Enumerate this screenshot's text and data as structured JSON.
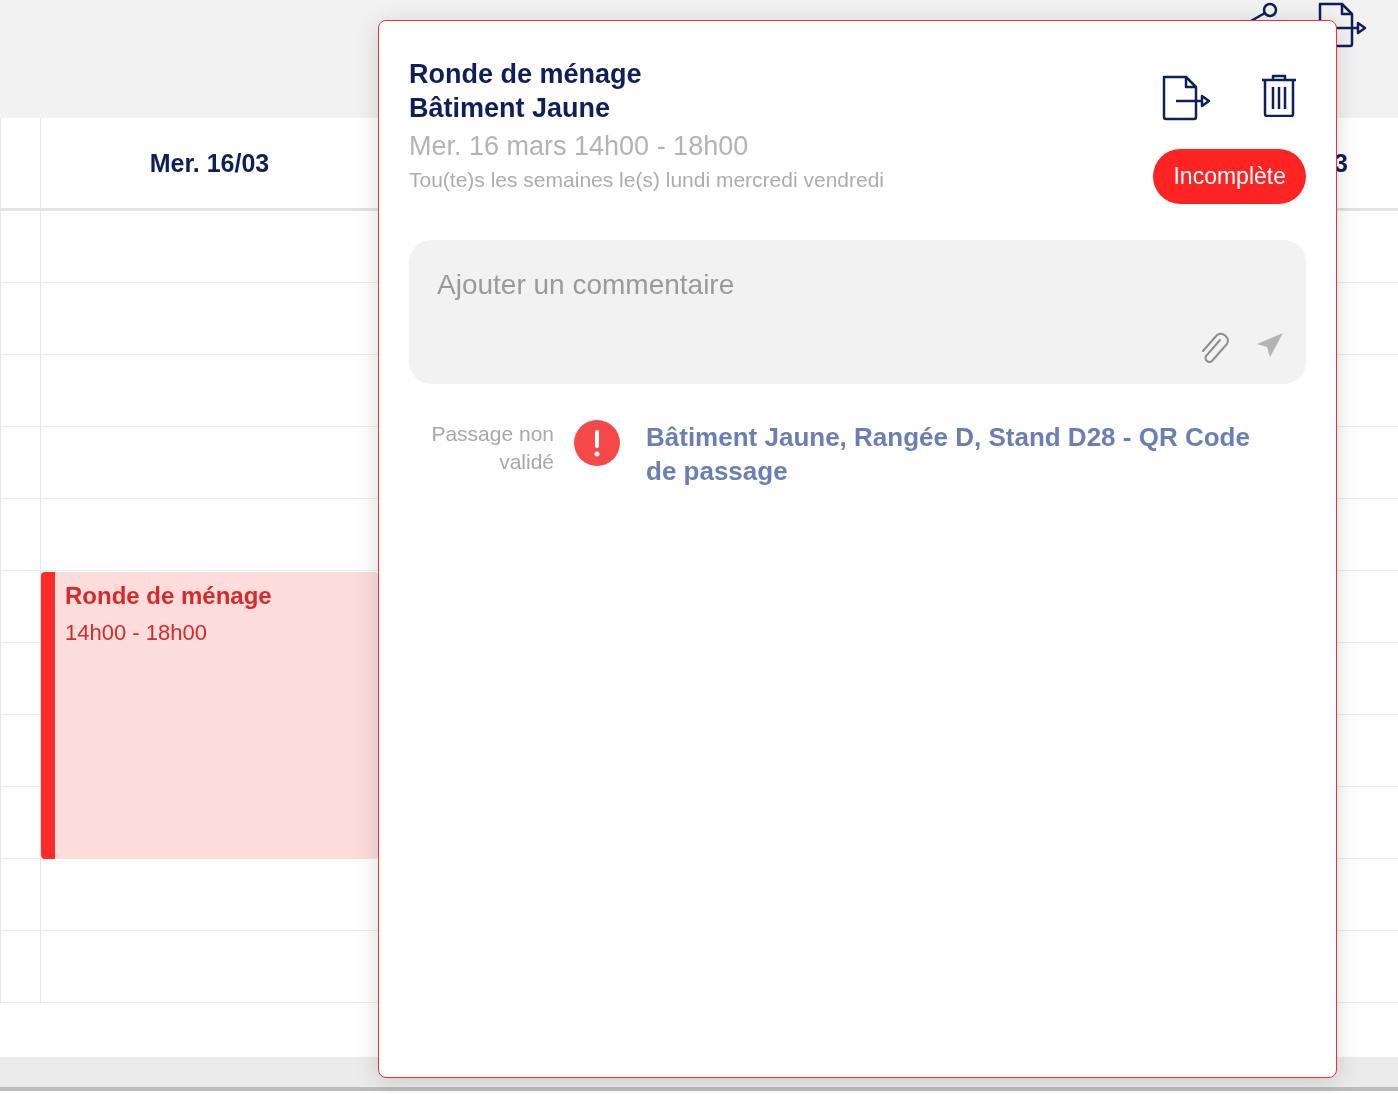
{
  "calendar": {
    "columns": [
      {
        "label": "Mer. 16/03"
      },
      {
        "label": "3"
      }
    ],
    "events": [
      {
        "title": "Ronde de ménage",
        "time": "14h00 - 18h00"
      }
    ]
  },
  "popup": {
    "title": "Ronde de ménage",
    "subtitle": "Bâtiment Jaune",
    "datetime": "Mer. 16 mars 14h00 - 18h00",
    "recurrence": "Tou(te)s les semaines le(s) lundi mercredi vendredi",
    "status": {
      "label": "Incomplète",
      "kind": "incomplete"
    },
    "comment": {
      "placeholder": "Ajouter un commentaire"
    },
    "checkpoints": [
      {
        "status_label": "Passage non validé",
        "validated": false,
        "label": "Bâtiment Jaune, Rangée D, Stand D28 - QR Code de passage"
      }
    ]
  }
}
